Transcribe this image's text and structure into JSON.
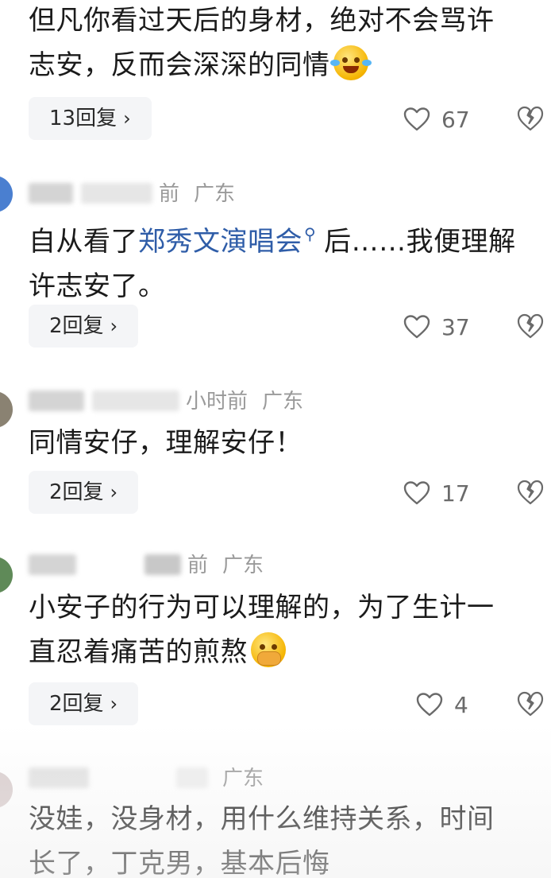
{
  "comments": [
    {
      "username": "",
      "time": "",
      "region": "",
      "text_lines": [
        "但凡你看过天后的身材，绝对不会骂许",
        "志安，反而会深深的同情"
      ],
      "emoji": "face-with-tears-of-joy",
      "reply_label": "13回复",
      "like_count": "67"
    },
    {
      "username": "",
      "time": "前",
      "region": "广东",
      "text_before": "自从看了",
      "link_text": "郑秀文演唱会",
      "text_after": "后……我便理解",
      "text_line2": "许志安了。",
      "reply_label": "2回复",
      "like_count": "37"
    },
    {
      "username": "",
      "time": "小时前",
      "region": "广东",
      "text_lines": [
        "同情安仔，理解安仔！"
      ],
      "reply_label": "2回复",
      "like_count": "17"
    },
    {
      "username": "",
      "time": "前",
      "region": "广东",
      "text_lines": [
        "小安子的行为可以理解的，为了生计一",
        "直忍着痛苦的煎熬"
      ],
      "emoji": "hand-over-mouth-face",
      "reply_label": "2回复",
      "like_count": "4"
    },
    {
      "username": "",
      "time": "",
      "region": "广东",
      "text_lines": [
        "没娃，没身材，用什么维持关系，时间",
        "长了，丁克男，基本后悔"
      ]
    }
  ],
  "colors": {
    "link": "#2f5da8",
    "meta": "#9a9a9a",
    "reply_bg": "#f4f5f7"
  },
  "icons": {
    "like": "heart-outline-icon",
    "dislike": "broken-heart-icon",
    "reply": "chevron-right-icon",
    "search": "search-icon"
  }
}
